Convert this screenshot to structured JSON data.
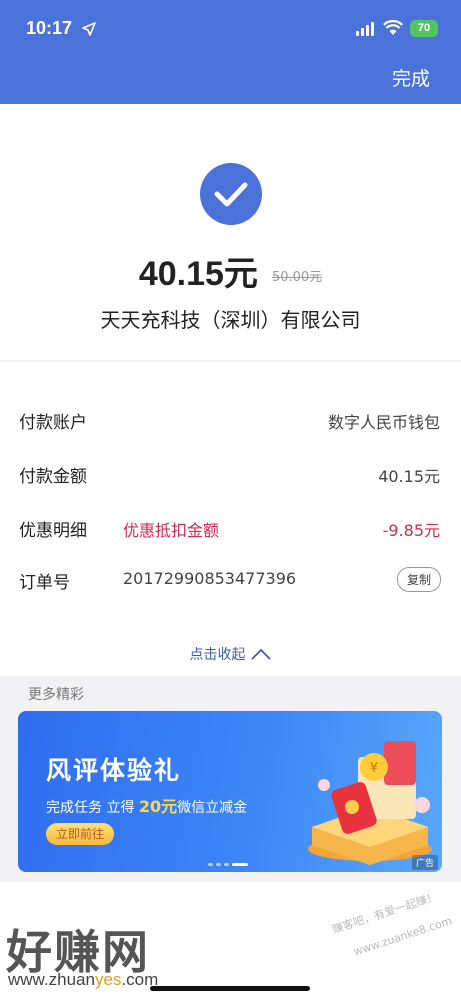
{
  "status_bar": {
    "time": "10:17",
    "battery": "70"
  },
  "header": {
    "done_label": "完成"
  },
  "payment": {
    "amount": "40.15元",
    "original_amount": "50.00元",
    "merchant": "天天充科技（深圳）有限公司"
  },
  "details": {
    "rows": [
      {
        "label": "付款账户",
        "value": "数字人民币钱包"
      },
      {
        "label": "付款金额",
        "value": "40.15元"
      },
      {
        "label": "优惠明细",
        "middle": "优惠抵扣金额",
        "value": "-9.85元"
      },
      {
        "label": "订单号",
        "middle": "20172990853477396",
        "button": "复制"
      }
    ],
    "collapse_label": "点击收起"
  },
  "more": {
    "title": "更多精彩",
    "banner": {
      "title": "风评体验礼",
      "subtitle_pre": "完成任务 立得",
      "subtitle_highlight": "20元",
      "subtitle_post": "微信立减金",
      "button": "立即前往",
      "ad_tag": "广告"
    }
  },
  "watermark": {
    "big": "好赚网",
    "url_pre": "www.zhuan",
    "url_hl": "yes",
    "url_post": ".com",
    "right_line1": "赚客吧，有爱一起赚！",
    "right_line2": "www.zuanke8.com"
  },
  "colors": {
    "primary": "#4a72d8",
    "discount_red": "#d42a4e",
    "link_blue": "#3d5fa8"
  }
}
